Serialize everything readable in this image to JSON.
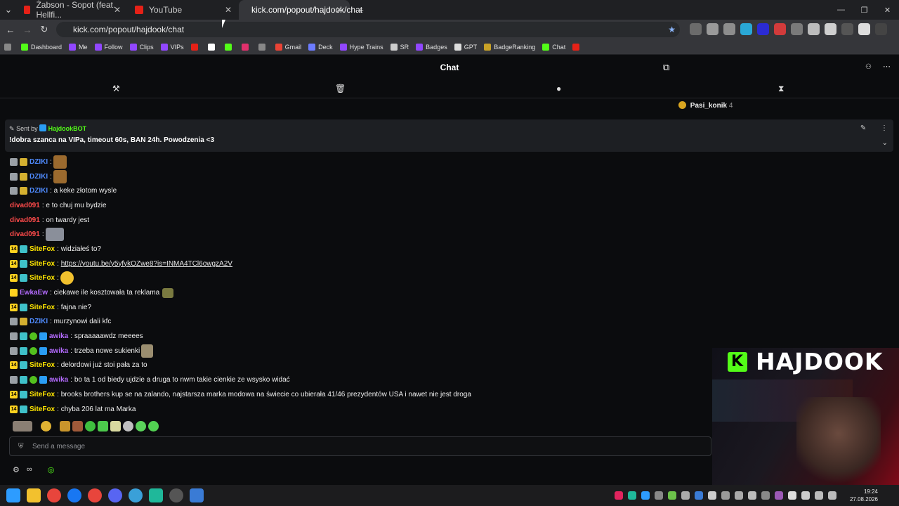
{
  "browser": {
    "tabs": [
      {
        "title": "Żabson - Sopot (feat. Hellfi...",
        "color": "#e62117"
      },
      {
        "title": "YouTube",
        "color": "#e62117"
      },
      {
        "title": "kick.com/popout/hajdook/chat",
        "color": "#53fc18"
      }
    ],
    "url": "kick.com/popout/hajdook/chat",
    "bookmarks": [
      {
        "label": "Dashboard",
        "color": "#53fc18"
      },
      {
        "label": "Me",
        "color": "#9147ff"
      },
      {
        "label": "Follow",
        "color": "#9147ff"
      },
      {
        "label": "Clips",
        "color": "#9147ff"
      },
      {
        "label": "VIPs",
        "color": "#9147ff"
      },
      {
        "label": "",
        "color": "#e62117"
      },
      {
        "label": "",
        "color": "#ffffff"
      },
      {
        "label": "",
        "color": "#53fc18"
      },
      {
        "label": "",
        "color": "#e1306c"
      },
      {
        "label": "",
        "color": "#888888"
      },
      {
        "label": "Gmail",
        "color": "#ea4335"
      },
      {
        "label": "Deck",
        "color": "#6c7bff"
      },
      {
        "label": "Hype Trains",
        "color": "#9147ff"
      },
      {
        "label": "SR",
        "color": "#cccccc"
      },
      {
        "label": "Badges",
        "color": "#9147ff"
      },
      {
        "label": "GPT",
        "color": "#dddddd"
      },
      {
        "label": "BadgeRanking",
        "color": "#c9a227"
      },
      {
        "label": "Chat",
        "color": "#53fc18"
      }
    ]
  },
  "chat": {
    "title": "Chat",
    "leader": {
      "name": "Pasi_konik",
      "count": "4"
    },
    "pinned": {
      "sent_by": "Sent by",
      "author": "HajdookBOT",
      "message": "!dobra szanca na VIPa, timeout 60s, BAN 24h. Powodzenia <3"
    },
    "messages": [
      {
        "user": "DZIKI",
        "color": "#4f8bff",
        "text": ""
      },
      {
        "user": "DZIKI",
        "color": "#4f8bff",
        "text": ""
      },
      {
        "user": "DZIKI",
        "color": "#4f8bff",
        "text": "a keke złotom wysle"
      },
      {
        "user": "divad091",
        "color": "#ff4b4b",
        "text": "e to chuj mu bydzie"
      },
      {
        "user": "divad091",
        "color": "#ff4b4b",
        "text": "on twardy jest"
      },
      {
        "user": "divad091",
        "color": "#ff4b4b",
        "text": ""
      },
      {
        "user": "SiteFox",
        "color": "#ffe600",
        "text": "widziałeś to?"
      },
      {
        "user": "SiteFox",
        "color": "#ffe600",
        "text": "https://youtu.be/y5yfykOZwe8?is=INMA4TCl6owgzA2V"
      },
      {
        "user": "SiteFox",
        "color": "#ffe600",
        "text": ""
      },
      {
        "user": "EwkaEw",
        "color": "#b46bff",
        "text": "ciekawe ile kosztowała ta reklama"
      },
      {
        "user": "SiteFox",
        "color": "#ffe600",
        "text": "fajna nie?"
      },
      {
        "user": "DZIKI",
        "color": "#4f8bff",
        "text": "murzynowi dali kfc"
      },
      {
        "user": "awika",
        "color": "#b46bff",
        "text": "spraaaaawdz meeees"
      },
      {
        "user": "awika",
        "color": "#b46bff",
        "text": "trzeba nowe sukienki"
      },
      {
        "user": "SiteFox",
        "color": "#ffe600",
        "text": "delordowi już stoi pała za to"
      },
      {
        "user": "awika",
        "color": "#b46bff",
        "text": "bo ta 1 od biedy ujdzie a druga to nwm takie cienkie ze wsysko widać"
      },
      {
        "user": "SiteFox",
        "color": "#ffe600",
        "text": "brooks brothers kup se na zalando, najstarsza marka modowa na świecie co ubierała 41/46 prezydentów USA i nawet nie jest droga"
      },
      {
        "user": "SiteFox",
        "color": "#ffe600",
        "text": "chyba 206 lat ma Marka"
      }
    ],
    "input_placeholder": "Send a message"
  },
  "overlay": {
    "brand": "HAJDOOK"
  },
  "clock": {
    "time": "19:24",
    "date": "27.08.2026"
  }
}
